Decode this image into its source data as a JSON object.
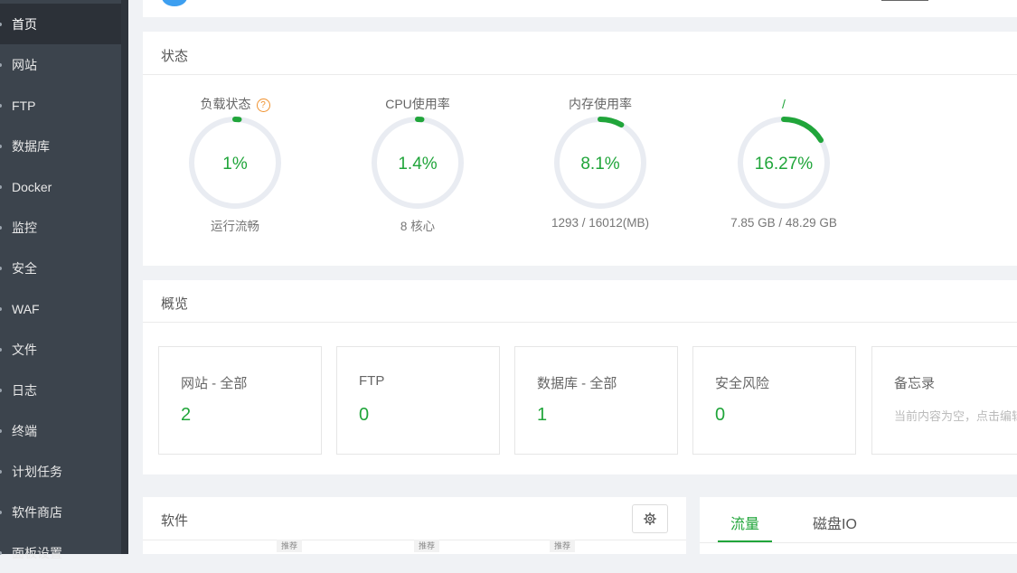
{
  "sidebar": {
    "items": [
      {
        "label": "首页",
        "active": true
      },
      {
        "label": "网站"
      },
      {
        "label": "FTP"
      },
      {
        "label": "数据库"
      },
      {
        "label": "Docker"
      },
      {
        "label": "监控"
      },
      {
        "label": "安全"
      },
      {
        "label": "WAF"
      },
      {
        "label": "文件"
      },
      {
        "label": "日志"
      },
      {
        "label": "终端"
      },
      {
        "label": "计划任务"
      },
      {
        "label": "软件商店"
      },
      {
        "label": "面板设置"
      }
    ]
  },
  "status": {
    "title": "状态",
    "gauges": [
      {
        "title": "负载状态",
        "value": "1%",
        "percent": 1,
        "sub": "运行流畅",
        "help_icon": "question-circle-icon"
      },
      {
        "title": "CPU使用率",
        "value": "1.4%",
        "percent": 1.4,
        "sub": "8 核心"
      },
      {
        "title": "内存使用率",
        "value": "8.1%",
        "percent": 8.1,
        "sub": "1293 / 16012(MB)"
      },
      {
        "title": "/",
        "value": "16.27%",
        "percent": 16.27,
        "sub": "7.85 GB / 48.29 GB"
      }
    ],
    "colors": {
      "ring_bg": "#e9ecf2",
      "ring_fg": "#20a53a"
    }
  },
  "overview": {
    "title": "概览",
    "cards": [
      {
        "title": "网站 - 全部",
        "value": "2"
      },
      {
        "title": "FTP",
        "value": "0"
      },
      {
        "title": "数据库 - 全部",
        "value": "1"
      },
      {
        "title": "安全风险",
        "value": "0"
      },
      {
        "title": "备忘录",
        "hint": "当前内容为空，点击编辑"
      }
    ]
  },
  "software": {
    "title": "软件",
    "settings_icon": "gear-icon",
    "badges": [
      "推荐",
      "推荐",
      "推荐"
    ]
  },
  "traffic": {
    "tabs": [
      {
        "label": "流量",
        "active": true
      },
      {
        "label": "磁盘IO"
      }
    ]
  },
  "colors": {
    "accent": "#20a53a",
    "sidebar_bg": "#3c444d",
    "warn": "#f0912e"
  }
}
